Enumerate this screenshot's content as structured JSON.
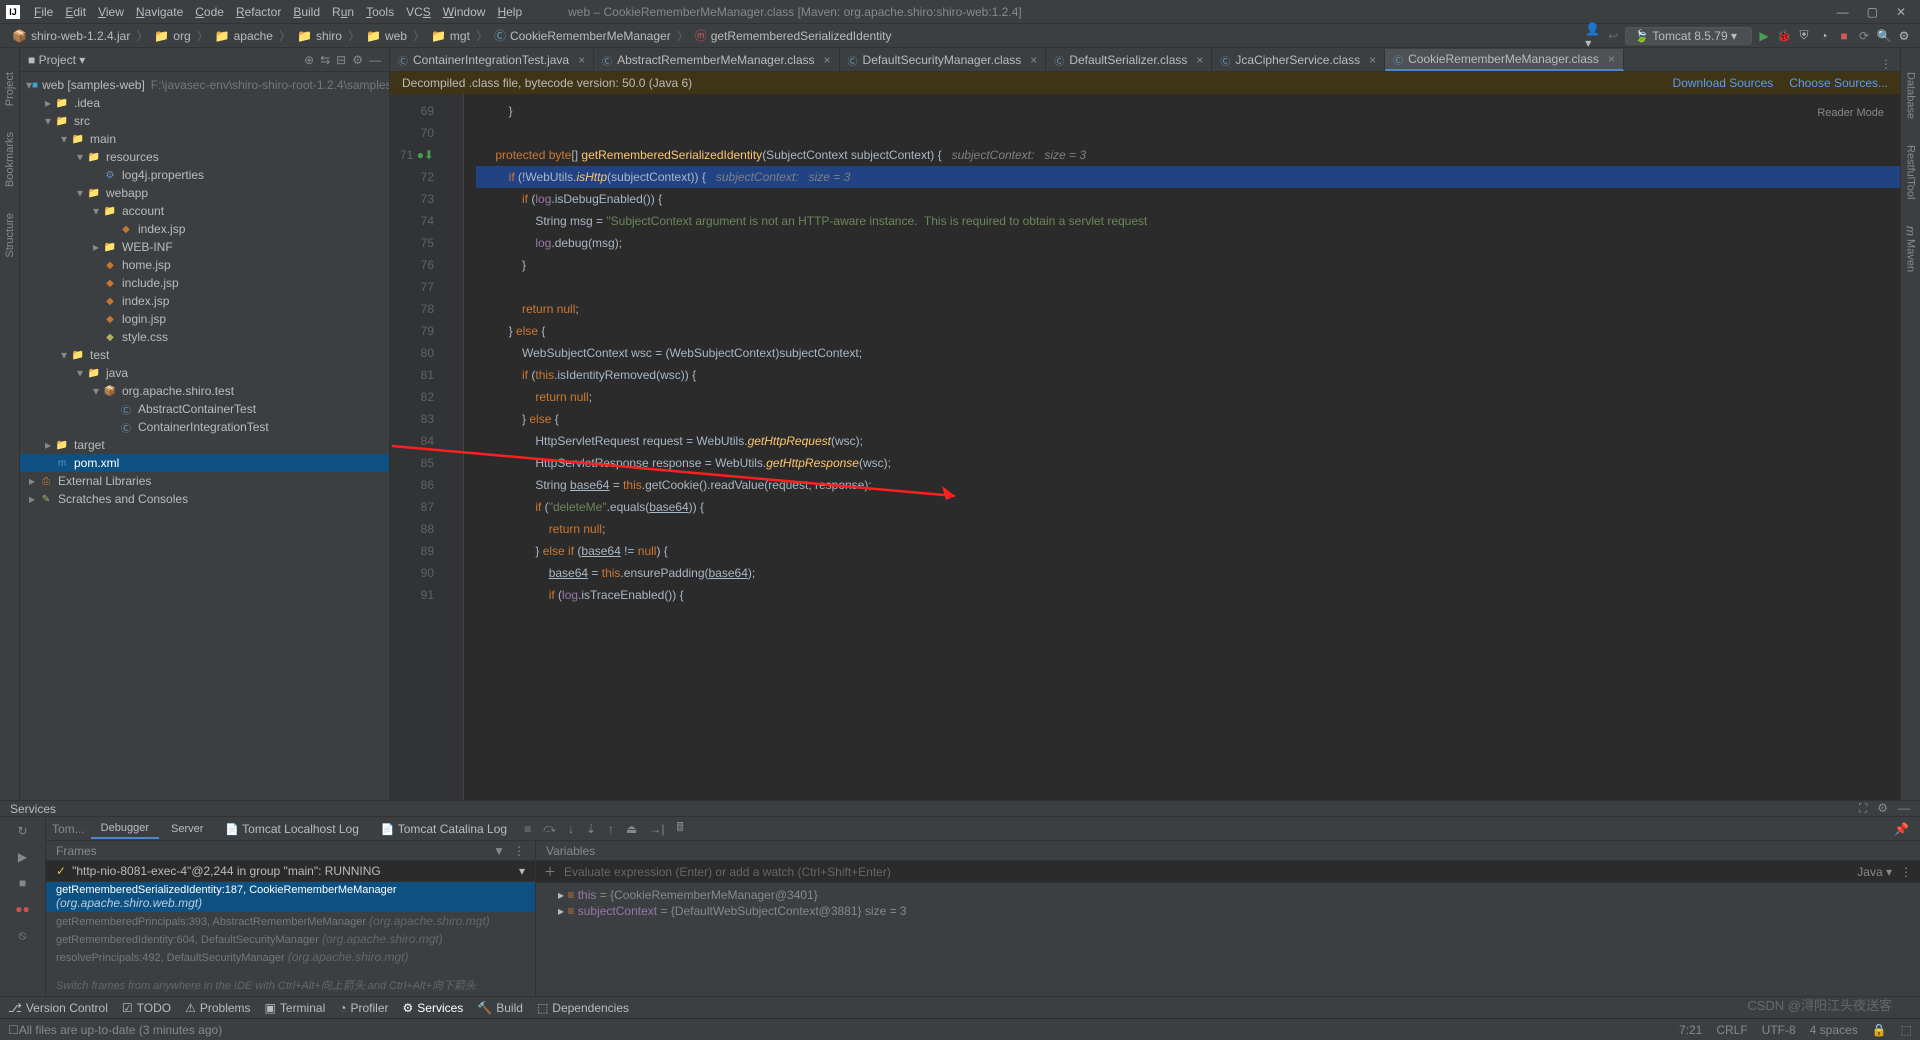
{
  "window_title": "web – CookieRememberMeManager.class [Maven: org.apache.shiro:shiro-web:1.2.4]",
  "menu": [
    "File",
    "Edit",
    "View",
    "Navigate",
    "Code",
    "Refactor",
    "Build",
    "Run",
    "Tools",
    "VCS",
    "Window",
    "Help"
  ],
  "menu_underline_idx": [
    0,
    0,
    0,
    0,
    0,
    0,
    0,
    1,
    0,
    2,
    0,
    0
  ],
  "breadcrumbs": [
    {
      "icon": "📦",
      "label": "shiro-web-1.2.4.jar"
    },
    {
      "icon": "📁",
      "label": "org"
    },
    {
      "icon": "📁",
      "label": "apache"
    },
    {
      "icon": "📁",
      "label": "shiro"
    },
    {
      "icon": "📁",
      "label": "web"
    },
    {
      "icon": "📁",
      "label": "mgt"
    },
    {
      "icon": "Ⓒ",
      "label": "CookieRememberMeManager",
      "cls": "blue"
    },
    {
      "icon": "ⓜ",
      "label": "getRememberedSerializedIdentity",
      "cls": "red"
    }
  ],
  "run_config": "Tomcat 8.5.79",
  "project_panel_title": "Project",
  "tree": [
    {
      "d": 0,
      "a": "▾",
      "i": "■",
      "ic": "fold-blue",
      "t": "web [samples-web]",
      "m": "F:\\javasec-env\\shiro-shiro-root-1.2.4\\samples\\web"
    },
    {
      "d": 1,
      "a": "▸",
      "i": "📁",
      "ic": "fold-orange",
      "t": ".idea"
    },
    {
      "d": 1,
      "a": "▾",
      "i": "📁",
      "ic": "fold-blue",
      "t": "src"
    },
    {
      "d": 2,
      "a": "▾",
      "i": "📁",
      "ic": "fold-blue",
      "t": "main"
    },
    {
      "d": 3,
      "a": "▾",
      "i": "📁",
      "ic": "fold-orange",
      "t": "resources"
    },
    {
      "d": 4,
      "a": "",
      "i": "⚙",
      "ic": "file-j",
      "t": "log4j.properties"
    },
    {
      "d": 3,
      "a": "▾",
      "i": "📁",
      "ic": "fold-blue",
      "t": "webapp"
    },
    {
      "d": 4,
      "a": "▾",
      "i": "📁",
      "ic": "fold-orange",
      "t": "account"
    },
    {
      "d": 5,
      "a": "",
      "i": "◆",
      "ic": "file-x",
      "t": "index.jsp"
    },
    {
      "d": 4,
      "a": "▸",
      "i": "📁",
      "ic": "fold-orange",
      "t": "WEB-INF"
    },
    {
      "d": 4,
      "a": "",
      "i": "◆",
      "ic": "file-x",
      "t": "home.jsp"
    },
    {
      "d": 4,
      "a": "",
      "i": "◆",
      "ic": "file-x",
      "t": "include.jsp"
    },
    {
      "d": 4,
      "a": "",
      "i": "◆",
      "ic": "file-x",
      "t": "index.jsp"
    },
    {
      "d": 4,
      "a": "",
      "i": "◆",
      "ic": "file-x",
      "t": "login.jsp"
    },
    {
      "d": 4,
      "a": "",
      "i": "◆",
      "ic": "file-c",
      "t": "style.css"
    },
    {
      "d": 2,
      "a": "▾",
      "i": "📁",
      "ic": "fold-blue",
      "t": "test"
    },
    {
      "d": 3,
      "a": "▾",
      "i": "📁",
      "ic": "fold-blue",
      "t": "java"
    },
    {
      "d": 4,
      "a": "▾",
      "i": "📦",
      "ic": "fold-orange",
      "t": "org.apache.shiro.test"
    },
    {
      "d": 5,
      "a": "",
      "i": "Ⓒ",
      "ic": "blue",
      "t": "AbstractContainerTest"
    },
    {
      "d": 5,
      "a": "",
      "i": "Ⓒ",
      "ic": "blue",
      "t": "ContainerIntegrationTest"
    },
    {
      "d": 1,
      "a": "▸",
      "i": "📁",
      "ic": "fold-orange",
      "t": "target"
    },
    {
      "d": 1,
      "a": "",
      "i": "m",
      "ic": "file-j",
      "t": "pom.xml",
      "sel": true
    },
    {
      "d": 0,
      "a": "▸",
      "i": "⎙",
      "ic": "fold-orange",
      "t": "External Libraries"
    },
    {
      "d": 0,
      "a": "▸",
      "i": "✎",
      "ic": "file-c",
      "t": "Scratches and Consoles"
    }
  ],
  "editor_tabs": [
    {
      "i": "Ⓒ",
      "t": "ContainerIntegrationTest.java"
    },
    {
      "i": "Ⓒ",
      "t": "AbstractRememberMeManager.class"
    },
    {
      "i": "Ⓒ",
      "t": "DefaultSecurityManager.class"
    },
    {
      "i": "Ⓒ",
      "t": "DefaultSerializer.class"
    },
    {
      "i": "Ⓒ",
      "t": "JcaCipherService.class"
    },
    {
      "i": "Ⓒ",
      "t": "CookieRememberMeManager.class",
      "active": true
    }
  ],
  "infobar_text": "Decompiled .class file, bytecode version: 50.0 (Java 6)",
  "infobar_links": [
    "Download Sources",
    "Choose Sources..."
  ],
  "reader_mode": "Reader Mode",
  "line_start": 69,
  "code_lines": [
    "        }",
    "",
    "    <span class='kw'>protected byte</span>[] <span class='fn'>getRememberedSerializedIdentity</span>(SubjectContext subjectContext) {   <span class='cm'>subjectContext:   size = 3</span>",
    "        <span class='kw'>if</span> (!WebUtils.<span class='fn' style='font-style:italic'>isHttp</span>(subjectContext)) {   <span class='cm'>subjectContext:   size = 3</span>",
    "            <span class='kw'>if</span> (<span class='fld'>log</span>.isDebugEnabled()) {",
    "                String msg = <span class='str'>\"SubjectContext argument is not an HTTP-aware instance.  This is required to obtain a servlet request</span>",
    "                <span class='fld'>log</span>.debug(msg);",
    "            }",
    "",
    "            <span class='kw'>return null</span>;",
    "        } <span class='kw'>else</span> {",
    "            WebSubjectContext wsc = (WebSubjectContext)subjectContext;",
    "            <span class='kw'>if</span> (<span class='kw'>this</span>.isIdentityRemoved(wsc)) {",
    "                <span class='kw'>return null</span>;",
    "            } <span class='kw'>else</span> {",
    "                HttpServletRequest request = WebUtils.<span class='fn' style='font-style:italic'>getHttpRequest</span>(wsc);",
    "                HttpServletResponse response = WebUtils.<span class='fn' style='font-style:italic'>getHttpResponse</span>(wsc);",
    "                String <u>base64</u> = <span class='kw'>this</span>.getCookie().readValue(request, response);",
    "                <span class='kw'>if</span> (<span class='str'>\"deleteMe\"</span>.equals(<u>base64</u>)) {",
    "                    <span class='kw'>return null</span>;",
    "                } <span class='kw'>else if</span> (<u>base64</u> != <span class='kw'>null</span>) {",
    "                    <u>base64</u> = <span class='kw'>this</span>.ensurePadding(<u>base64</u>);",
    "                    <span class='kw'>if</span> (<span class='fld'>log</span>.isTraceEnabled()) {"
  ],
  "highlight_line_index": 3,
  "services_title": "Services",
  "dbg_toolbar_tabs": [
    "Debugger",
    "Server"
  ],
  "dbg_log_tabs": [
    "Tomcat Localhost Log",
    "Tomcat Catalina Log"
  ],
  "frames_title": "Frames",
  "vars_title": "Variables",
  "thread_text": "\"http-nio-8081-exec-4\"@2,244 in group \"main\": RUNNING",
  "frames": [
    {
      "t": "getRememberedSerializedIdentity:187, CookieRememberMeManager",
      "p": "(org.apache.shiro.web.mgt)",
      "sel": true
    },
    {
      "t": "getRememberedPrincipals:393, AbstractRememberMeManager",
      "p": "(org.apache.shiro.mgt)"
    },
    {
      "t": "getRememberedIdentity:604, DefaultSecurityManager",
      "p": "(org.apache.shiro.mgt)"
    },
    {
      "t": "resolvePrincipals:492, DefaultSecurityManager",
      "p": "(org.apache.shiro.mgt)"
    }
  ],
  "frames_hint": "Switch frames from anywhere in the IDE with Ctrl+Alt+向上箭头 and Ctrl+Alt+向下箭头",
  "eval_placeholder": "Evaluate expression (Enter) or add a watch (Ctrl+Shift+Enter)",
  "eval_lang": "Java ▾",
  "variables": [
    {
      "k": "this",
      "v": "{CookieRememberMeManager@3401}"
    },
    {
      "k": "subjectContext",
      "v": "{DefaultWebSubjectContext@3881}  size = 3"
    }
  ],
  "bottom_tools": [
    {
      "i": "⎇",
      "t": "Version Control"
    },
    {
      "i": "☑",
      "t": "TODO"
    },
    {
      "i": "⚠",
      "t": "Problems"
    },
    {
      "i": "▣",
      "t": "Terminal"
    },
    {
      "i": "◔",
      "t": "Profiler"
    },
    {
      "i": "⚙",
      "t": "Services",
      "active": true
    },
    {
      "i": "🔨",
      "t": "Build"
    },
    {
      "i": "⬚",
      "t": "Dependencies"
    }
  ],
  "status_text": "All files are up-to-date (3 minutes ago)",
  "status_right": [
    "7:21",
    "CRLF",
    "UTF-8",
    "4 spaces",
    "🔒",
    "⬚"
  ],
  "watermark": "CSDN @浔阳江头夜送客"
}
